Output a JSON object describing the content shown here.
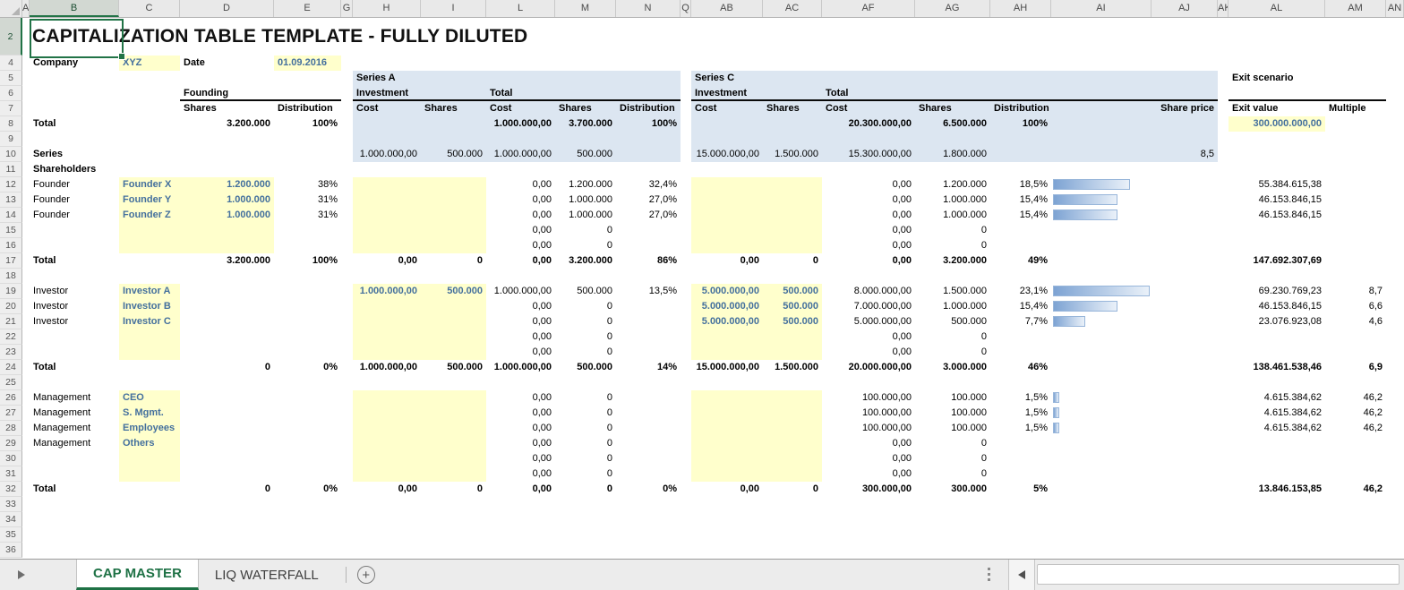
{
  "title": "CAPITALIZATION TABLE TEMPLATE - FULLY DILUTED",
  "selection": {
    "cell": "B2",
    "column": "B",
    "row": 2
  },
  "colors": {
    "accent_green": "#217346",
    "input_text": "#44709d",
    "section_bg": "#dce6f1",
    "input_bg": "#ffffcc",
    "bar_border": "#98b6da",
    "bar_fill_start": "#7da3d3",
    "bar_fill_end": "#eaf1f9"
  },
  "column_headers": [
    "A",
    "B",
    "C",
    "D",
    "E",
    "G",
    "H",
    "I",
    "L",
    "M",
    "N",
    "Q",
    "AB",
    "AC",
    "AF",
    "AG",
    "AH",
    "AI",
    "AJ",
    "AK",
    "AL",
    "AM",
    "AN"
  ],
  "tabs": {
    "active": "CAP MASTER",
    "inactive": "LIQ WATERFALL",
    "add": "+"
  },
  "sheet": {
    "rows": [
      {
        "n": 2,
        "title": true
      },
      {
        "n": 4,
        "cells": {
          "B": {
            "t": "Company",
            "s": "b"
          },
          "C": {
            "t": "XYZ",
            "s": "in"
          },
          "D": {
            "t": "Date",
            "s": "b l"
          },
          "E": {
            "t": "01.09.2016",
            "s": "in l"
          }
        }
      },
      {
        "n": 5,
        "cells": {
          "H": {
            "t": "Series A",
            "s": "b l"
          },
          "AB": {
            "t": "Series C",
            "s": "b l"
          },
          "AL": {
            "t": "Exit scenario",
            "s": "b l"
          }
        }
      },
      {
        "n": 6,
        "cells": {
          "D": {
            "t": "Founding",
            "s": "b l"
          },
          "H": {
            "t": "Investment",
            "s": "b l"
          },
          "L": {
            "t": "Total",
            "s": "b l"
          },
          "AB": {
            "t": "Investment",
            "s": "b l"
          },
          "AF": {
            "t": "Total",
            "s": "b l"
          }
        }
      },
      {
        "n": 7,
        "cells": {
          "D": {
            "t": "Shares",
            "s": "b l"
          },
          "E": {
            "t": "Distribution",
            "s": "b l"
          },
          "H": {
            "t": "Cost",
            "s": "b l"
          },
          "I": {
            "t": "Shares",
            "s": "b l"
          },
          "L": {
            "t": "Cost",
            "s": "b l"
          },
          "M": {
            "t": "Shares",
            "s": "b l"
          },
          "N": {
            "t": "Distribution",
            "s": "b l"
          },
          "AB": {
            "t": "Cost",
            "s": "b l"
          },
          "AC": {
            "t": "Shares",
            "s": "b l"
          },
          "AF": {
            "t": "Cost",
            "s": "b l"
          },
          "AG": {
            "t": "Shares",
            "s": "b l"
          },
          "AH": {
            "t": "Distribution",
            "s": "b l"
          },
          "AJ": {
            "t": "Share price",
            "s": "b"
          },
          "AL": {
            "t": "Exit value",
            "s": "b l"
          },
          "AM": {
            "t": "Multiple",
            "s": "b l"
          }
        }
      },
      {
        "n": 8,
        "cells": {
          "B": {
            "t": "Total",
            "s": "b"
          },
          "D": {
            "t": "3.200.000",
            "s": "b"
          },
          "E": {
            "t": "100%",
            "s": "b"
          },
          "L": {
            "t": "1.000.000,00",
            "s": "b"
          },
          "M": {
            "t": "3.700.000",
            "s": "b"
          },
          "N": {
            "t": "100%",
            "s": "b"
          },
          "AF": {
            "t": "20.300.000,00",
            "s": "b"
          },
          "AG": {
            "t": "6.500.000",
            "s": "b"
          },
          "AH": {
            "t": "100%",
            "s": "b"
          },
          "AL": {
            "t": "300.000.000,00",
            "s": "in"
          }
        }
      },
      {
        "n": 9
      },
      {
        "n": 10,
        "cells": {
          "B": {
            "t": "Series",
            "s": "b"
          },
          "H": {
            "t": "1.000.000,00"
          },
          "I": {
            "t": "500.000"
          },
          "L": {
            "t": "1.000.000,00"
          },
          "M": {
            "t": "500.000"
          },
          "AB": {
            "t": "15.000.000,00"
          },
          "AC": {
            "t": "1.500.000"
          },
          "AF": {
            "t": "15.300.000,00"
          },
          "AG": {
            "t": "1.800.000"
          },
          "AJ": {
            "t": "8,5"
          }
        }
      },
      {
        "n": 11,
        "cells": {
          "B": {
            "t": "Shareholders",
            "s": "b"
          }
        }
      },
      {
        "n": 12,
        "bar": 18.5,
        "cells": {
          "B": {
            "t": "Founder"
          },
          "C": {
            "t": "Founder X",
            "s": "in"
          },
          "D": {
            "t": "1.200.000",
            "s": "in"
          },
          "E": {
            "t": "38%"
          },
          "L": {
            "t": "0,00"
          },
          "M": {
            "t": "1.200.000"
          },
          "N": {
            "t": "32,4%"
          },
          "AF": {
            "t": "0,00"
          },
          "AG": {
            "t": "1.200.000"
          },
          "AH": {
            "t": "18,5%"
          },
          "AL": {
            "t": "55.384.615,38"
          }
        }
      },
      {
        "n": 13,
        "bar": 15.4,
        "cells": {
          "B": {
            "t": "Founder"
          },
          "C": {
            "t": "Founder Y",
            "s": "in"
          },
          "D": {
            "t": "1.000.000",
            "s": "in"
          },
          "E": {
            "t": "31%"
          },
          "L": {
            "t": "0,00"
          },
          "M": {
            "t": "1.000.000"
          },
          "N": {
            "t": "27,0%"
          },
          "AF": {
            "t": "0,00"
          },
          "AG": {
            "t": "1.000.000"
          },
          "AH": {
            "t": "15,4%"
          },
          "AL": {
            "t": "46.153.846,15"
          }
        }
      },
      {
        "n": 14,
        "bar": 15.4,
        "cells": {
          "B": {
            "t": "Founder"
          },
          "C": {
            "t": "Founder Z",
            "s": "in"
          },
          "D": {
            "t": "1.000.000",
            "s": "in"
          },
          "E": {
            "t": "31%"
          },
          "L": {
            "t": "0,00"
          },
          "M": {
            "t": "1.000.000"
          },
          "N": {
            "t": "27,0%"
          },
          "AF": {
            "t": "0,00"
          },
          "AG": {
            "t": "1.000.000"
          },
          "AH": {
            "t": "15,4%"
          },
          "AL": {
            "t": "46.153.846,15"
          }
        }
      },
      {
        "n": 15,
        "cells": {
          "L": {
            "t": "0,00"
          },
          "M": {
            "t": "0"
          },
          "AF": {
            "t": "0,00"
          },
          "AG": {
            "t": "0"
          }
        }
      },
      {
        "n": 16,
        "cells": {
          "L": {
            "t": "0,00"
          },
          "M": {
            "t": "0"
          },
          "AF": {
            "t": "0,00"
          },
          "AG": {
            "t": "0"
          }
        }
      },
      {
        "n": 17,
        "cells": {
          "B": {
            "t": "Total",
            "s": "b"
          },
          "D": {
            "t": "3.200.000",
            "s": "b"
          },
          "E": {
            "t": "100%",
            "s": "b"
          },
          "H": {
            "t": "0,00",
            "s": "b"
          },
          "I": {
            "t": "0",
            "s": "b"
          },
          "L": {
            "t": "0,00",
            "s": "b"
          },
          "M": {
            "t": "3.200.000",
            "s": "b"
          },
          "N": {
            "t": "86%",
            "s": "b"
          },
          "AB": {
            "t": "0,00",
            "s": "b"
          },
          "AC": {
            "t": "0",
            "s": "b"
          },
          "AF": {
            "t": "0,00",
            "s": "b"
          },
          "AG": {
            "t": "3.200.000",
            "s": "b"
          },
          "AH": {
            "t": "49%",
            "s": "b"
          },
          "AL": {
            "t": "147.692.307,69",
            "s": "b"
          }
        }
      },
      {
        "n": 18
      },
      {
        "n": 19,
        "bar": 23.1,
        "cells": {
          "B": {
            "t": "Investor"
          },
          "C": {
            "t": "Investor A",
            "s": "in"
          },
          "H": {
            "t": "1.000.000,00",
            "s": "in"
          },
          "I": {
            "t": "500.000",
            "s": "in"
          },
          "L": {
            "t": "1.000.000,00"
          },
          "M": {
            "t": "500.000"
          },
          "N": {
            "t": "13,5%"
          },
          "AB": {
            "t": "5.000.000,00",
            "s": "in"
          },
          "AC": {
            "t": "500.000",
            "s": "in"
          },
          "AF": {
            "t": "8.000.000,00"
          },
          "AG": {
            "t": "1.500.000"
          },
          "AH": {
            "t": "23,1%"
          },
          "AL": {
            "t": "69.230.769,23"
          },
          "AM": {
            "t": "8,7"
          }
        }
      },
      {
        "n": 20,
        "bar": 15.4,
        "cells": {
          "B": {
            "t": "Investor"
          },
          "C": {
            "t": "Investor B",
            "s": "in"
          },
          "L": {
            "t": "0,00"
          },
          "M": {
            "t": "0"
          },
          "AB": {
            "t": "5.000.000,00",
            "s": "in"
          },
          "AC": {
            "t": "500.000",
            "s": "in"
          },
          "AF": {
            "t": "7.000.000,00"
          },
          "AG": {
            "t": "1.000.000"
          },
          "AH": {
            "t": "15,4%"
          },
          "AL": {
            "t": "46.153.846,15"
          },
          "AM": {
            "t": "6,6"
          }
        }
      },
      {
        "n": 21,
        "bar": 7.7,
        "cells": {
          "B": {
            "t": "Investor"
          },
          "C": {
            "t": "Investor C",
            "s": "in"
          },
          "L": {
            "t": "0,00"
          },
          "M": {
            "t": "0"
          },
          "AB": {
            "t": "5.000.000,00",
            "s": "in"
          },
          "AC": {
            "t": "500.000",
            "s": "in"
          },
          "AF": {
            "t": "5.000.000,00"
          },
          "AG": {
            "t": "500.000"
          },
          "AH": {
            "t": "7,7%"
          },
          "AL": {
            "t": "23.076.923,08"
          },
          "AM": {
            "t": "4,6"
          }
        }
      },
      {
        "n": 22,
        "cells": {
          "L": {
            "t": "0,00"
          },
          "M": {
            "t": "0"
          },
          "AF": {
            "t": "0,00"
          },
          "AG": {
            "t": "0"
          }
        }
      },
      {
        "n": 23,
        "cells": {
          "L": {
            "t": "0,00"
          },
          "M": {
            "t": "0"
          },
          "AF": {
            "t": "0,00"
          },
          "AG": {
            "t": "0"
          }
        }
      },
      {
        "n": 24,
        "cells": {
          "B": {
            "t": "Total",
            "s": "b"
          },
          "D": {
            "t": "0",
            "s": "b"
          },
          "E": {
            "t": "0%",
            "s": "b"
          },
          "H": {
            "t": "1.000.000,00",
            "s": "b"
          },
          "I": {
            "t": "500.000",
            "s": "b"
          },
          "L": {
            "t": "1.000.000,00",
            "s": "b"
          },
          "M": {
            "t": "500.000",
            "s": "b"
          },
          "N": {
            "t": "14%",
            "s": "b"
          },
          "AB": {
            "t": "15.000.000,00",
            "s": "b"
          },
          "AC": {
            "t": "1.500.000",
            "s": "b"
          },
          "AF": {
            "t": "20.000.000,00",
            "s": "b"
          },
          "AG": {
            "t": "3.000.000",
            "s": "b"
          },
          "AH": {
            "t": "46%",
            "s": "b"
          },
          "AL": {
            "t": "138.461.538,46",
            "s": "b"
          },
          "AM": {
            "t": "6,9",
            "s": "b"
          }
        }
      },
      {
        "n": 25
      },
      {
        "n": 26,
        "bar": 1.5,
        "cells": {
          "B": {
            "t": "Management"
          },
          "C": {
            "t": "CEO",
            "s": "in"
          },
          "L": {
            "t": "0,00"
          },
          "M": {
            "t": "0"
          },
          "AF": {
            "t": "100.000,00"
          },
          "AG": {
            "t": "100.000"
          },
          "AH": {
            "t": "1,5%"
          },
          "AL": {
            "t": "4.615.384,62"
          },
          "AM": {
            "t": "46,2"
          }
        }
      },
      {
        "n": 27,
        "bar": 1.5,
        "cells": {
          "B": {
            "t": "Management"
          },
          "C": {
            "t": "S. Mgmt.",
            "s": "in"
          },
          "L": {
            "t": "0,00"
          },
          "M": {
            "t": "0"
          },
          "AF": {
            "t": "100.000,00"
          },
          "AG": {
            "t": "100.000"
          },
          "AH": {
            "t": "1,5%"
          },
          "AL": {
            "t": "4.615.384,62"
          },
          "AM": {
            "t": "46,2"
          }
        }
      },
      {
        "n": 28,
        "bar": 1.5,
        "cells": {
          "B": {
            "t": "Management"
          },
          "C": {
            "t": "Employees",
            "s": "in"
          },
          "L": {
            "t": "0,00"
          },
          "M": {
            "t": "0"
          },
          "AF": {
            "t": "100.000,00"
          },
          "AG": {
            "t": "100.000"
          },
          "AH": {
            "t": "1,5%"
          },
          "AL": {
            "t": "4.615.384,62"
          },
          "AM": {
            "t": "46,2"
          }
        }
      },
      {
        "n": 29,
        "cells": {
          "B": {
            "t": "Management"
          },
          "C": {
            "t": "Others",
            "s": "in"
          },
          "L": {
            "t": "0,00"
          },
          "M": {
            "t": "0"
          },
          "AF": {
            "t": "0,00"
          },
          "AG": {
            "t": "0"
          }
        }
      },
      {
        "n": 30,
        "cells": {
          "L": {
            "t": "0,00"
          },
          "M": {
            "t": "0"
          },
          "AF": {
            "t": "0,00"
          },
          "AG": {
            "t": "0"
          }
        }
      },
      {
        "n": 31,
        "cells": {
          "L": {
            "t": "0,00"
          },
          "M": {
            "t": "0"
          },
          "AF": {
            "t": "0,00"
          },
          "AG": {
            "t": "0"
          }
        }
      },
      {
        "n": 32,
        "cells": {
          "B": {
            "t": "Total",
            "s": "b"
          },
          "D": {
            "t": "0",
            "s": "b"
          },
          "E": {
            "t": "0%",
            "s": "b"
          },
          "H": {
            "t": "0,00",
            "s": "b"
          },
          "I": {
            "t": "0",
            "s": "b"
          },
          "L": {
            "t": "0,00",
            "s": "b"
          },
          "M": {
            "t": "0",
            "s": "b"
          },
          "N": {
            "t": "0%",
            "s": "b"
          },
          "AB": {
            "t": "0,00",
            "s": "b"
          },
          "AC": {
            "t": "0",
            "s": "b"
          },
          "AF": {
            "t": "300.000,00",
            "s": "b"
          },
          "AG": {
            "t": "300.000",
            "s": "b"
          },
          "AH": {
            "t": "5%",
            "s": "b"
          },
          "AL": {
            "t": "13.846.153,85",
            "s": "b"
          },
          "AM": {
            "t": "46,2",
            "s": "b"
          }
        }
      },
      {
        "n": 33
      },
      {
        "n": 34
      },
      {
        "n": 35
      },
      {
        "n": 36
      }
    ]
  }
}
